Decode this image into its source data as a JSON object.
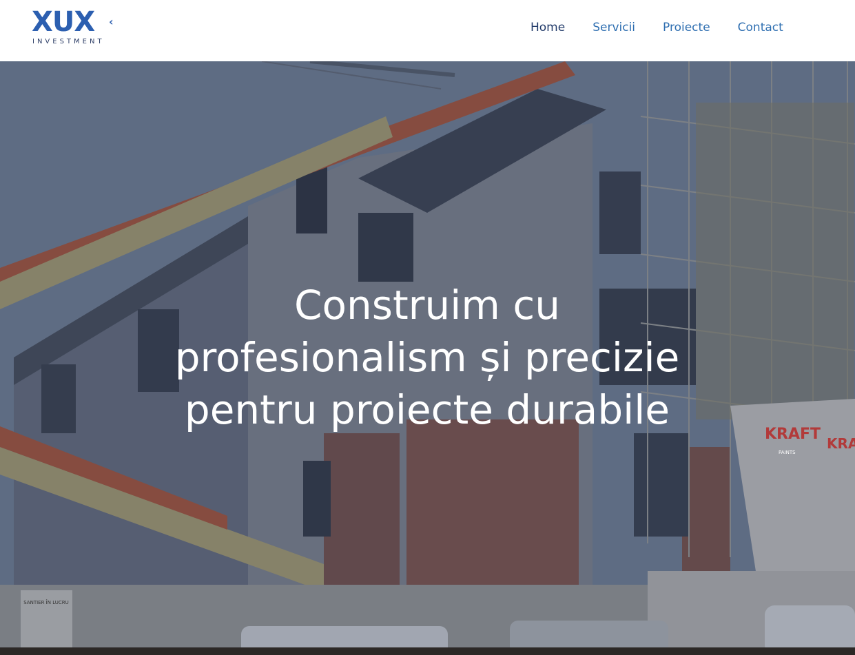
{
  "brand": {
    "logo_text": "XUX",
    "logo_subtitle": "INVESTMENT",
    "color": "#2c5fb0"
  },
  "nav": {
    "items": [
      {
        "label": "Home",
        "active": true
      },
      {
        "label": "Servicii",
        "active": false
      },
      {
        "label": "Proiecte",
        "active": false
      },
      {
        "label": "Contact",
        "active": false
      }
    ]
  },
  "hero": {
    "headline": "Construim cu profesionalism și precizie pentru proiecte durabile",
    "headline_lines": [
      "Construim cu",
      "profesionalism și precizie",
      "pentru proiecte durabile"
    ],
    "image": "construction-site-photo",
    "sign_texts": [
      "SANTIER ÎN LUCRU",
      "KRAFT",
      "PAINTS"
    ]
  }
}
